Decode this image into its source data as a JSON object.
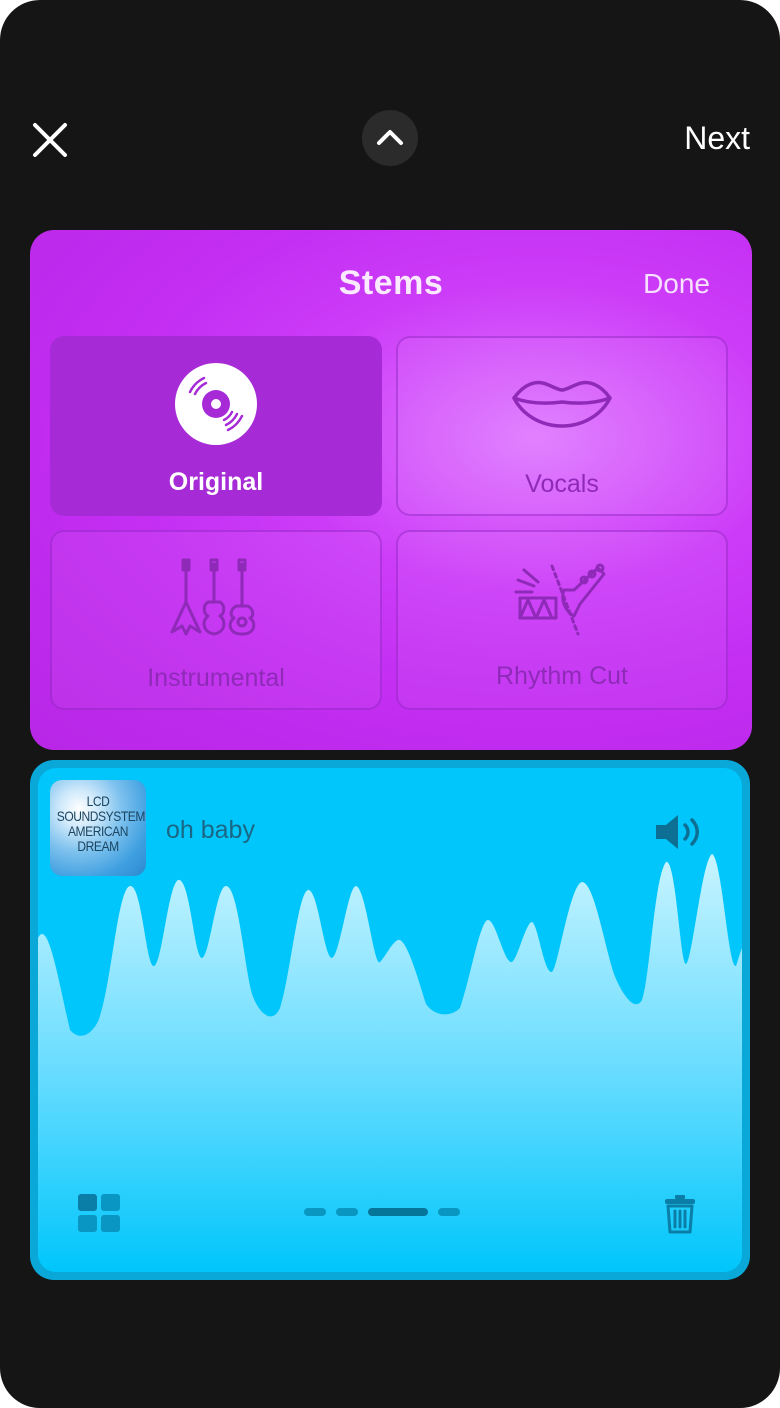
{
  "top_bar": {
    "next_label": "Next"
  },
  "stems": {
    "title": "Stems",
    "done_label": "Done",
    "options": [
      {
        "label": "Original",
        "icon": "vinyl-record-icon",
        "selected": true
      },
      {
        "label": "Vocals",
        "icon": "lips-icon",
        "selected": false
      },
      {
        "label": "Instrumental",
        "icon": "guitars-icon",
        "selected": false
      },
      {
        "label": "Rhythm Cut",
        "icon": "drum-guitar-cut-icon",
        "selected": false
      }
    ]
  },
  "track": {
    "name": "oh baby",
    "album_art_text": "LCD\nSOUNDSYSTEM\nAMERICAN\nDREAM",
    "pager": {
      "count": 4,
      "active_index": 2
    }
  },
  "colors": {
    "background": "#151515",
    "stems_panel": "#c32ef2",
    "stem_selected": "#a62bd6",
    "track_card": "#00c6fb"
  }
}
